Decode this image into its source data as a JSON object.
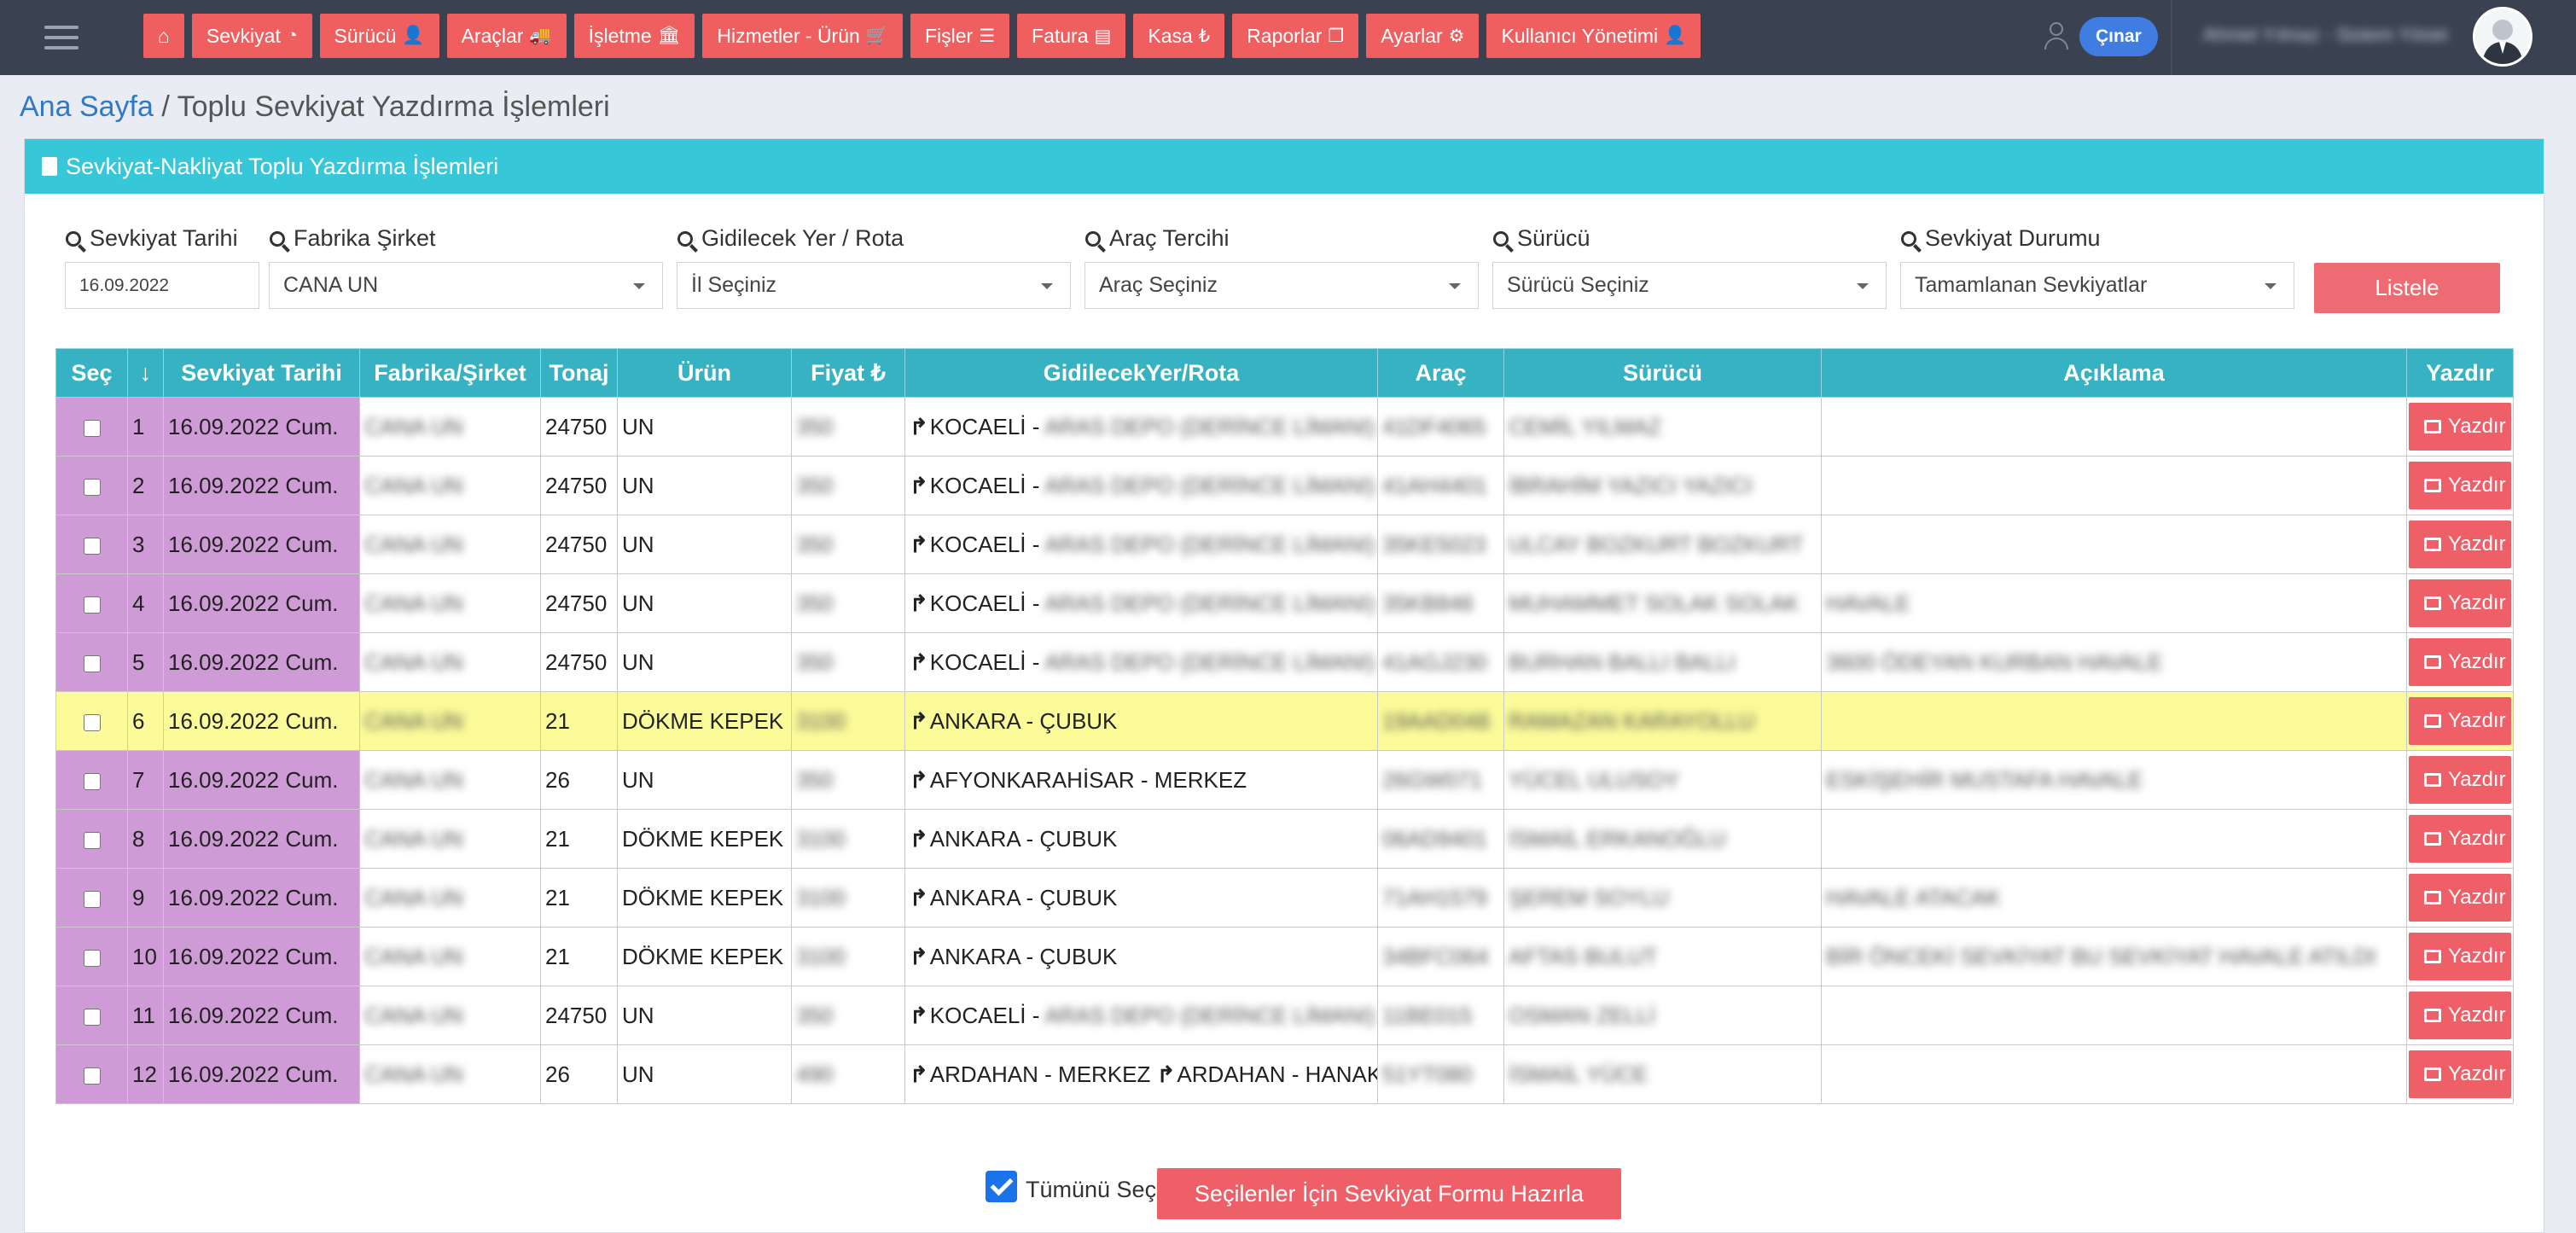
{
  "nav": {
    "home_icon": "home-icon",
    "items": [
      {
        "label": "Sevkiyat",
        "icon": "dashboard-icon",
        "glyph": "◔"
      },
      {
        "label": "Sürücü",
        "icon": "user-icon",
        "glyph": "👤"
      },
      {
        "label": "Araçlar",
        "icon": "truck-icon",
        "glyph": "🚚"
      },
      {
        "label": "İşletme",
        "icon": "bank-icon",
        "glyph": "🏛"
      },
      {
        "label": "Hizmetler - Ürün",
        "icon": "cart-icon",
        "glyph": "🛒"
      },
      {
        "label": "Fişler",
        "icon": "database-icon",
        "glyph": "☰"
      },
      {
        "label": "Fatura",
        "icon": "list-icon",
        "glyph": "▤"
      },
      {
        "label": "Kasa",
        "icon": "lira-icon",
        "glyph": "₺"
      },
      {
        "label": "Raporlar",
        "icon": "copy-icon",
        "glyph": "❐"
      },
      {
        "label": "Ayarlar",
        "icon": "gears-icon",
        "glyph": "⚙"
      },
      {
        "label": "Kullanıcı Yönetimi",
        "icon": "user-icon",
        "glyph": "👤"
      }
    ],
    "logout_label": "Çınar",
    "username": "Ahmet Yılmaz - Sistem Yöneticisi"
  },
  "breadcrumb": {
    "home": "Ana Sayfa",
    "separator": " / ",
    "current": "Toplu Sevkiyat Yazdırma İşlemleri"
  },
  "panel": {
    "title": "Sevkiyat-Nakliyat Toplu Yazdırma İşlemleri"
  },
  "filters": {
    "date_label": "Sevkiyat Tarihi",
    "date_value": "16.09.2022",
    "company_label": "Fabrika Şirket",
    "company_value": "CANA UN",
    "route_label": "Gidilecek Yer / Rota",
    "route_value": "İl Seçiniz",
    "vehicle_label": "Araç Tercihi",
    "vehicle_value": "Araç Seçiniz",
    "driver_label": "Sürücü",
    "driver_value": "Sürücü Seçiniz",
    "status_label": "Sevkiyat Durumu",
    "status_value": "Tamamlanan Sevkiyatlar",
    "list_button": "Listele"
  },
  "table": {
    "headers": {
      "sec": "Seç",
      "sort": "↓",
      "date": "Sevkiyat Tarihi",
      "company": "Fabrika/Şirket",
      "tonnage": "Tonaj",
      "product": "Ürün",
      "price": "Fiyat ₺",
      "route": "GidilecekYer/Rota",
      "vehicle": "Araç",
      "driver": "Sürücü",
      "desc": "Açıklama",
      "print": "Yazdır"
    },
    "print_label": "Yazdır",
    "rows": [
      {
        "no": "1",
        "date": "16.09.2022 Cum.",
        "company": "CANA UN",
        "tonnage": "24750",
        "product": "UN",
        "price": "350",
        "route": "KOCAELİ - ",
        "route_blur": "ARAS DEPO (DERİNCE LİMANI)",
        "vehicle": "41DF4065",
        "driver": "CEMİL YILMAZ",
        "desc": ""
      },
      {
        "no": "2",
        "date": "16.09.2022 Cum.",
        "company": "CANA UN",
        "tonnage": "24750",
        "product": "UN",
        "price": "350",
        "route": "KOCAELİ - ",
        "route_blur": "ARAS DEPO (DERİNCE LİMANI)",
        "vehicle": "41AH4401",
        "driver": "İBRAHİM YAZICI YAZICI",
        "desc": ""
      },
      {
        "no": "3",
        "date": "16.09.2022 Cum.",
        "company": "CANA UN",
        "tonnage": "24750",
        "product": "UN",
        "price": "350",
        "route": "KOCAELİ - ",
        "route_blur": "ARAS DEPO (DERİNCE LİMANI)",
        "vehicle": "35KE5023",
        "driver": "ULCAY BOZKURT BOZKURT",
        "desc": ""
      },
      {
        "no": "4",
        "date": "16.09.2022 Cum.",
        "company": "CANA UN",
        "tonnage": "24750",
        "product": "UN",
        "price": "350",
        "route": "KOCAELİ - ",
        "route_blur": "ARAS DEPO (DERİNCE LİMANI)",
        "vehicle": "35KB846",
        "driver": "MUHAMMET SOLAK SOLAK",
        "desc": "HAVALE"
      },
      {
        "no": "5",
        "date": "16.09.2022 Cum.",
        "company": "CANA UN",
        "tonnage": "24750",
        "product": "UN",
        "price": "350",
        "route": "KOCAELİ - ",
        "route_blur": "ARAS DEPO (DERİNCE LİMANI)",
        "vehicle": "41AGJ230",
        "driver": "BURHAN BALLI BALLI",
        "desc": "3600 ÖDEYAN KURBAN HAVALE"
      },
      {
        "no": "6",
        "date": "16.09.2022 Cum.",
        "company": "CANA UN",
        "tonnage": "21",
        "product": "DÖKME KEPEK",
        "price": "3100",
        "route": "ANKARA - ÇUBUK",
        "route_blur": "",
        "vehicle": "19AAD048",
        "driver": "RAMAZAN KARAYOLLU",
        "desc": ""
      },
      {
        "no": "7",
        "date": "16.09.2022 Cum.",
        "company": "CANA UN",
        "tonnage": "26",
        "product": "UN",
        "price": "350",
        "route": "AFYONKARAHİSAR - MERKEZ",
        "route_blur": "",
        "vehicle": "26GW071",
        "driver": "YÜCEL ULUSOY",
        "desc": "ESKİŞEHİR MUSTAFA HAVALE"
      },
      {
        "no": "8",
        "date": "16.09.2022 Cum.",
        "company": "CANA UN",
        "tonnage": "21",
        "product": "DÖKME KEPEK",
        "price": "3100",
        "route": "ANKARA - ÇUBUK",
        "route_blur": "",
        "vehicle": "06AD9401",
        "driver": "İSMAİL ERKANOĞLU",
        "desc": ""
      },
      {
        "no": "9",
        "date": "16.09.2022 Cum.",
        "company": "CANA UN",
        "tonnage": "21",
        "product": "DÖKME KEPEK",
        "price": "3100",
        "route": "ANKARA - ÇUBUK",
        "route_blur": "",
        "vehicle": "71AH1579",
        "driver": "ŞEREM SOYLU",
        "desc": "HAVALE ATACAK"
      },
      {
        "no": "10",
        "date": "16.09.2022 Cum.",
        "company": "CANA UN",
        "tonnage": "21",
        "product": "DÖKME KEPEK",
        "price": "3100",
        "route": "ANKARA - ÇUBUK",
        "route_blur": "",
        "vehicle": "34BFC064",
        "driver": "AFTAS BULUT",
        "desc": "BİR ÖNCEKİ SEVKİYAT BU SEVKİYAT HAVALE ATILDI"
      },
      {
        "no": "11",
        "date": "16.09.2022 Cum.",
        "company": "CANA UN",
        "tonnage": "24750",
        "product": "UN",
        "price": "350",
        "route": "KOCAELİ - ",
        "route_blur": "ARAS DEPO (DERİNCE LİMANI)",
        "vehicle": "11BE015",
        "driver": "OSMAN ZELLİ",
        "desc": ""
      },
      {
        "no": "12",
        "date": "16.09.2022 Cum.",
        "company": "CANA UN",
        "tonnage": "26",
        "product": "UN",
        "price": "490",
        "route": "ARDAHAN - MERKEZ ",
        "route_blur": "",
        "route2": "ARDAHAN - HANAK",
        "vehicle": "51YT080",
        "driver": "İSMAİL YÜCE",
        "desc": ""
      }
    ],
    "highlighted_row": 6
  },
  "footer": {
    "select_all_label": "Tümünü Seç",
    "select_all_checked": true,
    "prepare_button": "Seçilenler İçin Sevkiyat Formu Hazırla"
  },
  "colors": {
    "nav_bg": "#3a4251",
    "accent_red": "#ef5f5f",
    "panel_head": "#36c7d8",
    "table_head": "#36b2c2",
    "pink_cell": "#cf9bd6",
    "highlight": "#fbfb9a",
    "link": "#2f79c7"
  }
}
